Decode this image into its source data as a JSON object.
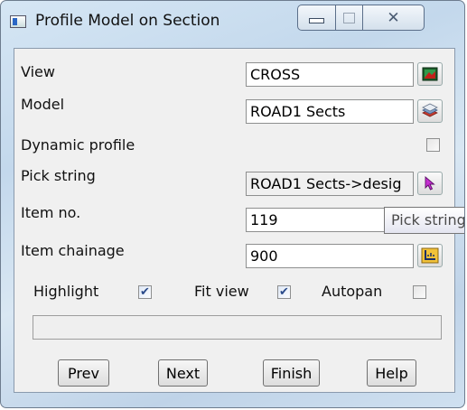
{
  "window": {
    "title": "Profile Model on Section"
  },
  "form": {
    "view_label": "View",
    "view_value": "CROSS",
    "model_label": "Model",
    "model_value": "ROAD1 Sects",
    "dynamic_profile_label": "Dynamic profile",
    "dynamic_profile_checked": false,
    "pick_string_label": "Pick string",
    "pick_string_value": "ROAD1 Sects->desig",
    "item_no_label": "Item no.",
    "item_no_value": "119",
    "item_chainage_label": "Item chainage",
    "item_chainage_value": "900"
  },
  "options": {
    "highlight_label": "Highlight",
    "highlight_checked": true,
    "fit_view_label": "Fit view",
    "fit_view_checked": true,
    "autopan_label": "Autopan",
    "autopan_checked": false
  },
  "status_text": "",
  "buttons": {
    "prev": "Prev",
    "next": "Next",
    "finish": "Finish",
    "help": "Help"
  },
  "tooltip": "Pick string",
  "icons": {
    "view": "view-picture-icon",
    "model": "layers-icon",
    "pick": "arrow-cursor-icon",
    "chainage": "chainage-ruler-icon"
  }
}
